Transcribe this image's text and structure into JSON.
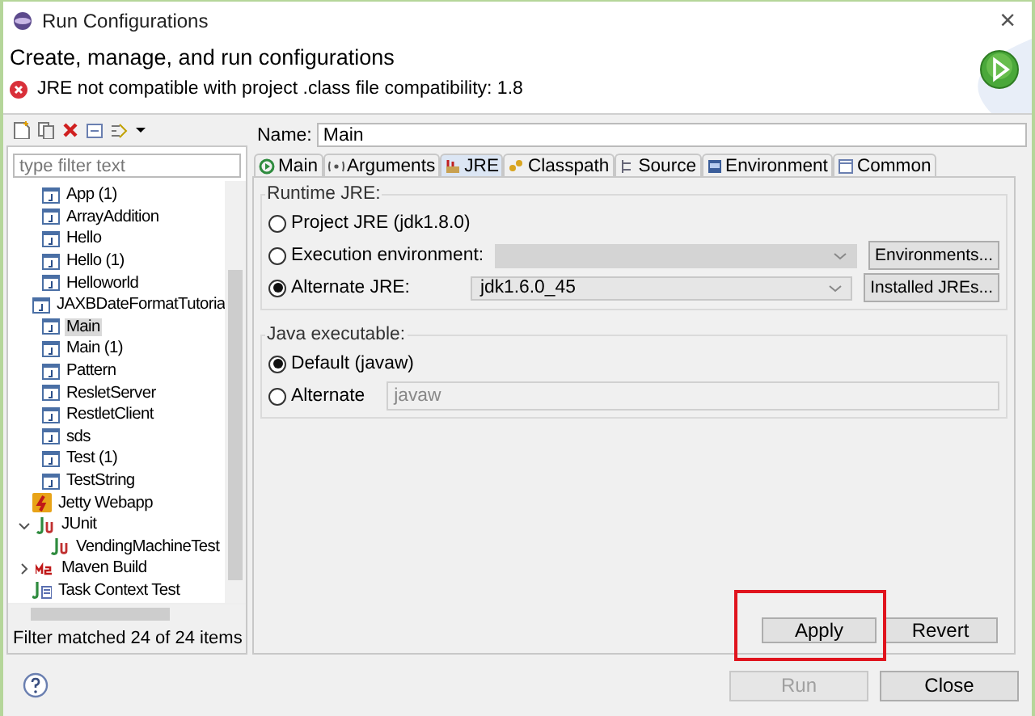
{
  "window": {
    "title": "Run Configurations",
    "close": "×"
  },
  "header": {
    "title": "Create, manage, and run configurations",
    "error": "JRE not compatible with project .class file compatibility: 1.8"
  },
  "sidebar": {
    "filter": {
      "placeholder": "type filter text"
    },
    "scrolled_items": [
      {
        "label": "App (1)",
        "kind": "java",
        "selected": false
      },
      {
        "label": "ArrayAddition",
        "kind": "java",
        "selected": false
      },
      {
        "label": "Hello",
        "kind": "java",
        "selected": false
      },
      {
        "label": "Hello (1)",
        "kind": "java",
        "selected": false
      },
      {
        "label": "Helloworld",
        "kind": "java",
        "selected": false
      },
      {
        "label": "JAXBDateFormatTutoria",
        "kind": "java",
        "selected": false
      },
      {
        "label": "Main",
        "kind": "java",
        "selected": true
      },
      {
        "label": "Main (1)",
        "kind": "java",
        "selected": false
      },
      {
        "label": "Pattern",
        "kind": "java",
        "selected": false
      },
      {
        "label": "ResletServer",
        "kind": "java",
        "selected": false
      },
      {
        "label": "RestletClient",
        "kind": "java",
        "selected": false
      },
      {
        "label": "sds",
        "kind": "java",
        "selected": false
      },
      {
        "label": "Test (1)",
        "kind": "java",
        "selected": false
      },
      {
        "label": "TestString",
        "kind": "java",
        "selected": false
      }
    ],
    "items": [
      {
        "label": "Jetty Webapp",
        "kind": "jetty",
        "selected": false
      },
      {
        "label": "JUnit",
        "kind": "junit",
        "selected": false,
        "expanded": true,
        "children": [
          {
            "label": "VendingMachineTest",
            "kind": "junit",
            "selected": false
          }
        ]
      },
      {
        "label": "Maven Build",
        "kind": "maven",
        "selected": false,
        "expanded": false
      },
      {
        "label": "Task Context Test",
        "kind": "task",
        "selected": false
      }
    ],
    "status": "Filter matched 24 of 24 items"
  },
  "config": {
    "name_label": "Name:",
    "name": "Main",
    "tabs": [
      {
        "label": "Main",
        "selected": false
      },
      {
        "label": "Arguments",
        "selected": false
      },
      {
        "label": "JRE",
        "selected": true
      },
      {
        "label": "Classpath",
        "selected": false
      },
      {
        "label": "Source",
        "selected": false
      },
      {
        "label": "Environment",
        "selected": false
      },
      {
        "label": "Common",
        "selected": false
      }
    ],
    "runtime_jre": {
      "title": "Runtime JRE:",
      "options": [
        {
          "label": "Project JRE (jdk1.8.0)",
          "selected": false
        },
        {
          "label": "Execution environment:",
          "selected": false,
          "dropdown": {
            "disabled": true
          },
          "button": "Environments..."
        },
        {
          "label": "Alternate JRE:",
          "selected": true,
          "dropdown": {
            "value": "jdk1.6.0_45",
            "disabled": false
          },
          "button": "Installed JREs..."
        }
      ]
    },
    "java_executable": {
      "title": "Java executable:",
      "options": [
        {
          "label": "Default (javaw)",
          "selected": true
        },
        {
          "label": "Alternate",
          "selected": false,
          "field": "javaw"
        }
      ]
    },
    "buttons": [
      {
        "label": "Apply",
        "highlighted": true
      },
      {
        "label": "Revert",
        "highlighted": false
      }
    ]
  },
  "footer": {
    "buttons": [
      {
        "label": "Run",
        "disabled": true
      },
      {
        "label": "Close",
        "disabled": false
      }
    ]
  }
}
